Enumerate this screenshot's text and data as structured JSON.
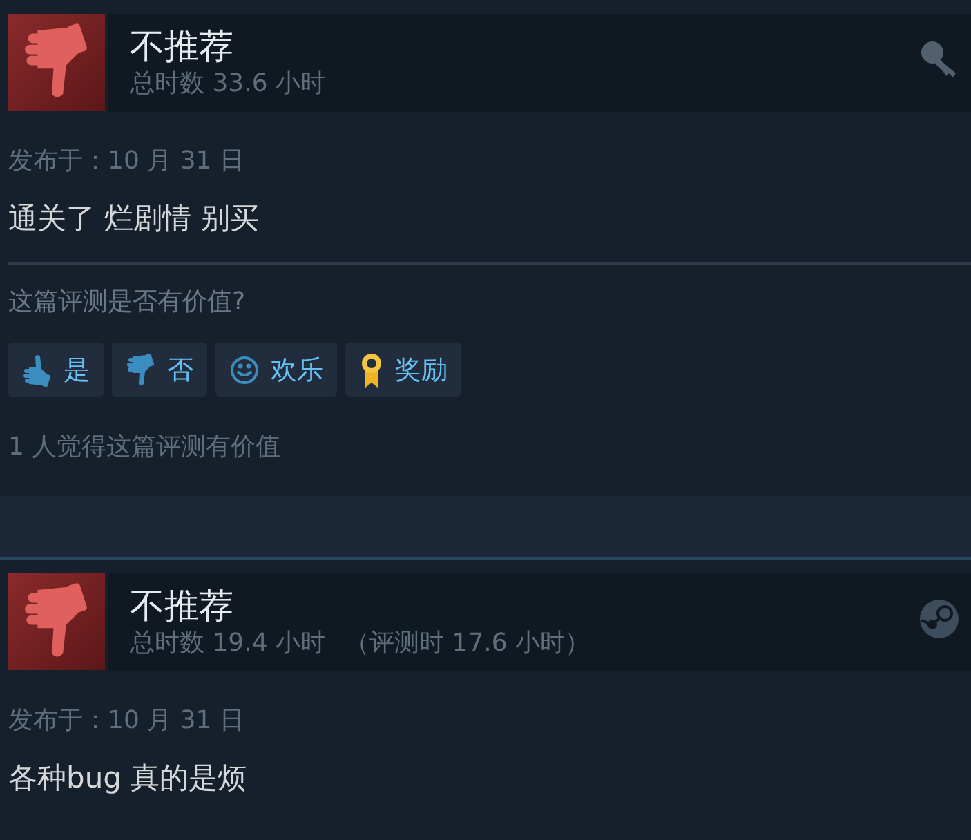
{
  "reviews": [
    {
      "recommended": false,
      "verdict": "不推荐",
      "hours": "总时数 33.6 小时",
      "kind": "key",
      "posted": "发布于：10 月 31 日",
      "text": "通关了 烂剧情 别买",
      "helpful_prompt": "这篇评测是否有价值?",
      "buttons": [
        {
          "kind": "yes",
          "label": "是"
        },
        {
          "kind": "no",
          "label": "否"
        },
        {
          "kind": "funny",
          "label": "欢乐"
        },
        {
          "kind": "award",
          "label": "奖励"
        }
      ],
      "helpful_count": "1 人觉得这篇评测有价值"
    },
    {
      "recommended": false,
      "verdict": "不推荐",
      "hours": "总时数 19.4 小时",
      "hours_at_review": "（评测时 17.6 小时）",
      "kind": "steam",
      "posted": "发布于：10 月 31 日",
      "text": "各种bug 真的是烦"
    }
  ]
}
